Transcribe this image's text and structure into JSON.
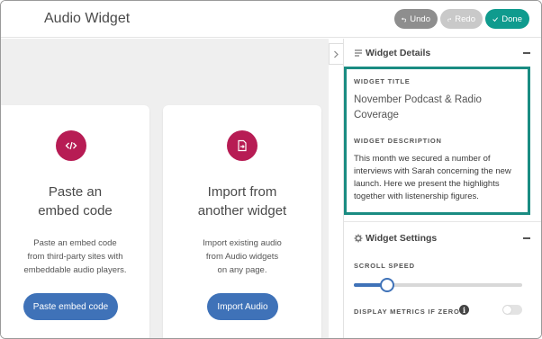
{
  "header": {
    "title": "Audio Widget",
    "undo_label": "Undo",
    "redo_label": "Redo",
    "done_label": "Done"
  },
  "cards": [
    {
      "icon": "code-icon",
      "title": "Paste an\nembed code",
      "description": "Paste an embed code\nfrom third-party sites with\nembeddable audio players.",
      "button_label": "Paste embed code"
    },
    {
      "icon": "import-file-icon",
      "title": "Import from\nanother widget",
      "description": "Import existing audio\nfrom Audio widgets\non any page.",
      "button_label": "Import Audio"
    }
  ],
  "panel": {
    "details": {
      "heading": "Widget Details",
      "title_label": "WIDGET TITLE",
      "title_value": "November Podcast & Radio Coverage",
      "description_label": "WIDGET DESCRIPTION",
      "description_value": "This month we secured a number of interviews with Sarah concerning the new launch. Here we present the highlights together with listenership figures."
    },
    "settings": {
      "heading": "Widget Settings",
      "scroll_speed_label": "SCROLL SPEED",
      "scroll_speed_value": 0.2,
      "display_metrics_label": "DISPLAY METRICS IF ZERO",
      "display_metrics_enabled": false
    }
  },
  "colors": {
    "accent_teal": "#0f9b8e",
    "highlight_border": "#1a8c82",
    "primary_blue": "#3f72b8",
    "card_icon_bg": "#b71c54"
  }
}
